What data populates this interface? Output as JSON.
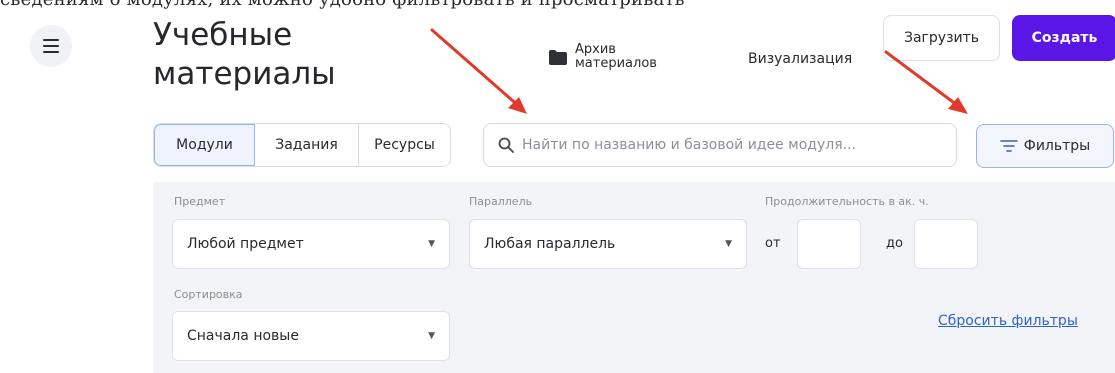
{
  "caption_text": "сведениям о модулях, их можно удобно фильтровать и просматривать",
  "header": {
    "title_line1": "Учебные",
    "title_line2": "материалы",
    "archive_label": "Архив материалов",
    "visualization_label": "Визуализация",
    "upload_label": "Загрузить",
    "create_label": "Создать",
    "create_color": "#5a16e6"
  },
  "tabs": [
    {
      "label": "Модули",
      "active": true
    },
    {
      "label": "Задания",
      "active": false
    },
    {
      "label": "Ресурсы",
      "active": false
    }
  ],
  "search": {
    "placeholder": "Найти по названию и базовой идее модуля..."
  },
  "filters_button": "Фильтры",
  "filters": {
    "subject_label": "Предмет",
    "subject_value": "Любой предмет",
    "grade_label": "Параллель",
    "grade_value": "Любая параллель",
    "duration_label": "Продолжительность в ак. ч.",
    "from_label": "от",
    "to_label": "до",
    "sort_label": "Сортировка",
    "sort_value": "Сначала новые",
    "reset_label": "Сбросить фильтры"
  },
  "icons": {
    "menu": "hamburger-icon",
    "archive": "folder-icon",
    "search": "search-icon",
    "filters": "filter-lines-icon",
    "dropdown": "caret-down-icon",
    "annotation": "red-arrow"
  },
  "annotation_color": "#e03a2a"
}
